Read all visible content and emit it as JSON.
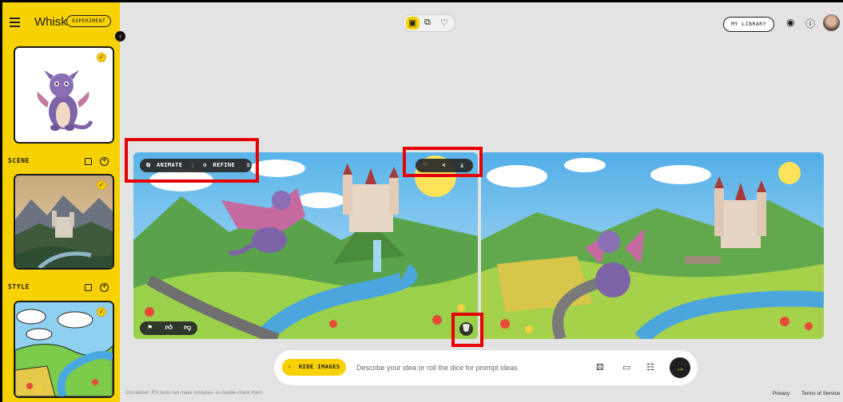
{
  "app": {
    "brand": "Whisk",
    "badge": "EXPERIMENT"
  },
  "sidebar": {
    "scene_label": "SCENE",
    "style_label": "STYLE"
  },
  "topbar": {
    "library_label": "MY LIBRARY"
  },
  "image_actions": {
    "animate_label": "ANIMATE",
    "refine_label": "REFINE"
  },
  "prompt_bar": {
    "hide_label": "HIDE IMAGES",
    "placeholder": "Describe your idea or roll the dice for prompt ideas"
  },
  "footer": {
    "disclaimer": "Disclaimer: /FX tools can make mistakes, so double-check them",
    "privacy": "Privacy",
    "terms": "Terms of Service"
  },
  "colors": {
    "accent": "#f8d100",
    "highlight_box": "#e60000"
  }
}
